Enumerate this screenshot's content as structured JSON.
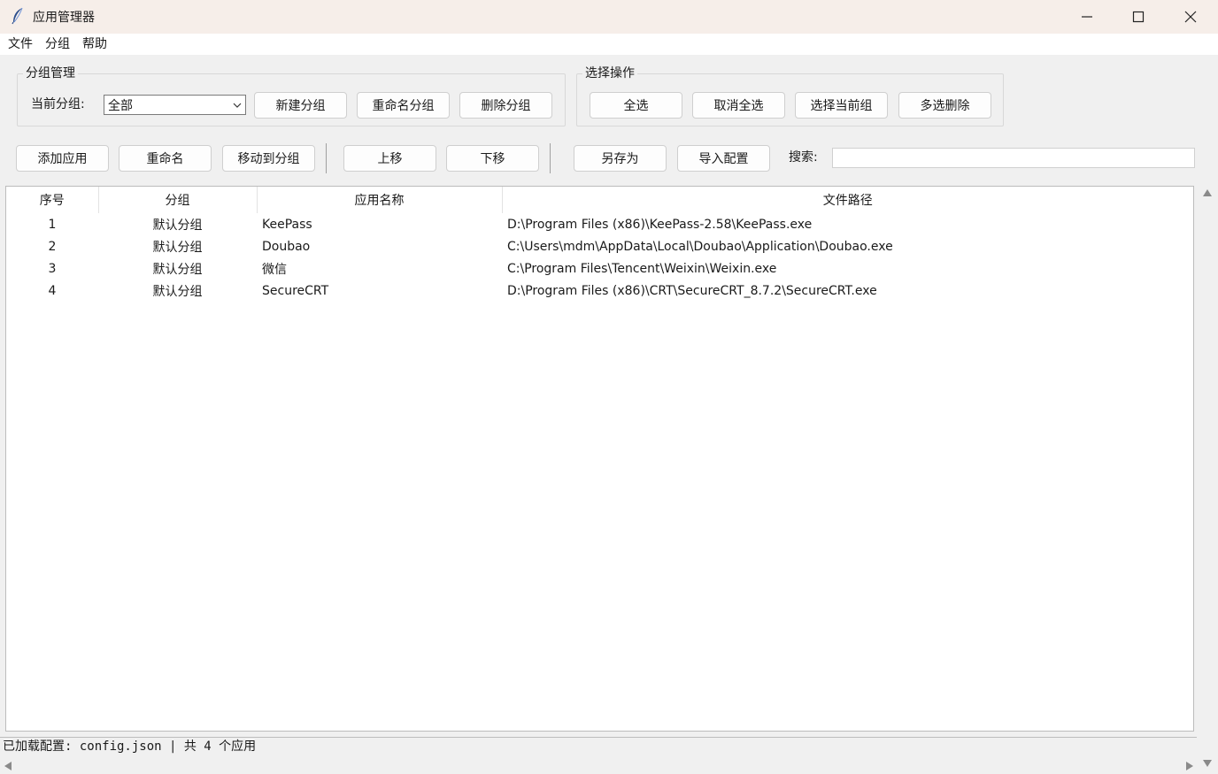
{
  "window": {
    "title": "应用管理器"
  },
  "menu": {
    "items": [
      "文件",
      "分组",
      "帮助"
    ]
  },
  "group_management": {
    "title": "分组管理",
    "current_group_label": "当前分组:",
    "current_group_value": "全部",
    "buttons": [
      "新建分组",
      "重命名分组",
      "删除分组"
    ]
  },
  "selection_ops": {
    "title": "选择操作",
    "buttons": [
      "全选",
      "取消全选",
      "选择当前组",
      "多选删除"
    ]
  },
  "toolbar": {
    "add_app": "添加应用",
    "rename": "重命名",
    "move_to_group": "移动到分组",
    "move_up": "上移",
    "move_down": "下移",
    "save_as": "另存为",
    "import_config": "导入配置",
    "search_label": "搜索:",
    "search_value": ""
  },
  "table": {
    "columns": [
      "序号",
      "分组",
      "应用名称",
      "文件路径"
    ],
    "rows": [
      [
        "1",
        "默认分组",
        "KeePass",
        "D:\\Program Files (x86)\\KeePass-2.58\\KeePass.exe"
      ],
      [
        "2",
        "默认分组",
        "Doubao",
        "C:\\Users\\mdm\\AppData\\Local\\Doubao\\Application\\Doubao.exe"
      ],
      [
        "3",
        "默认分组",
        "微信",
        "C:\\Program Files\\Tencent\\Weixin\\Weixin.exe"
      ],
      [
        "4",
        "默认分组",
        "SecureCRT",
        "D:\\Program Files (x86)\\CRT\\SecureCRT_8.7.2\\SecureCRT.exe"
      ]
    ]
  },
  "status": {
    "text": "已加载配置: config.json | 共 4 个应用"
  }
}
